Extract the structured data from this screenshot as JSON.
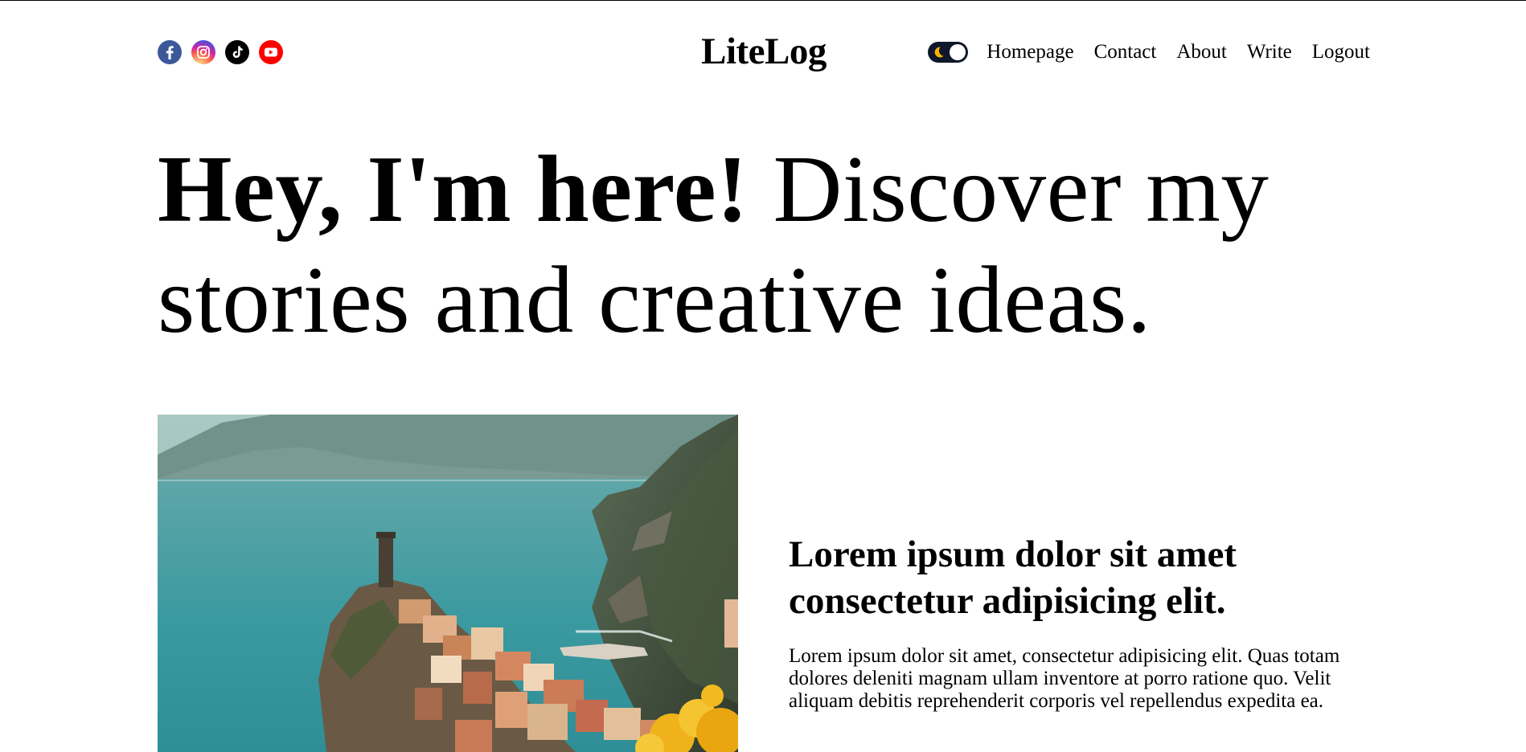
{
  "header": {
    "social": [
      {
        "name": "facebook-icon",
        "color": "#3b5998"
      },
      {
        "name": "instagram-icon",
        "color": "#d6249f"
      },
      {
        "name": "tiktok-icon",
        "color": "#000000"
      },
      {
        "name": "youtube-icon",
        "color": "#ff0000"
      }
    ],
    "logo": "LiteLog",
    "theme_toggle": {
      "state": "dark",
      "icon": "moon-icon",
      "track_color": "#0f172a"
    },
    "nav": {
      "homepage": "Homepage",
      "contact": "Contact",
      "about": "About",
      "write": "Write",
      "logout": "Logout"
    }
  },
  "hero": {
    "bold": "Hey, I'm here!",
    "rest": " Discover my stories and creative ideas."
  },
  "featured": {
    "image_alt": "coastal-village-photo",
    "title": "Lorem ipsum dolor sit amet consectetur adipisicing elit.",
    "description": "Lorem ipsum dolor sit amet, consectetur adipisicing elit. Quas totam dolores deleniti magnam ullam inventore at porro ratione quo. Velit aliquam debitis reprehenderit corporis vel repellendus expedita ea."
  }
}
